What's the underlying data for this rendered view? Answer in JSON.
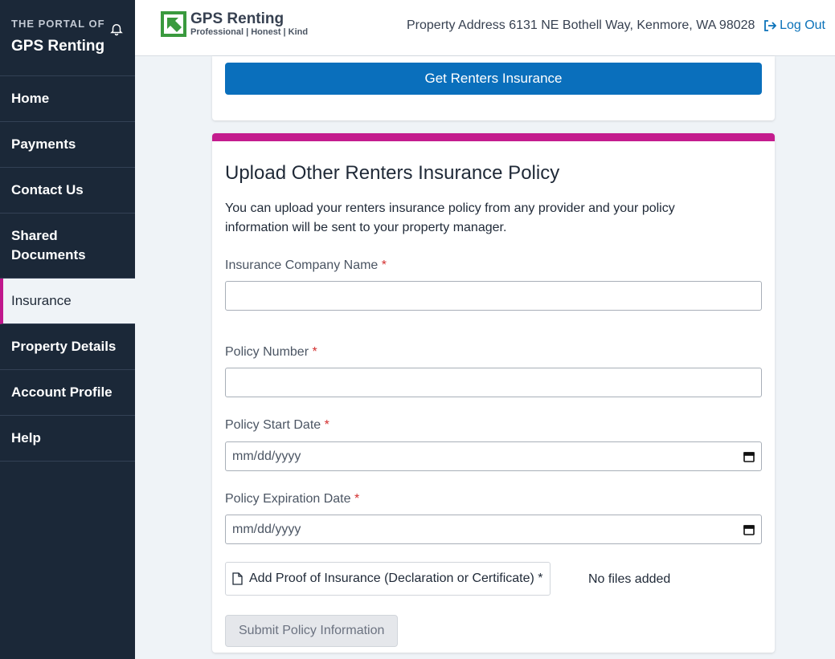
{
  "sidebar": {
    "portal_small": "THE PORTAL OF",
    "portal_name": "GPS Renting",
    "items": [
      {
        "label": "Home"
      },
      {
        "label": "Payments"
      },
      {
        "label": "Contact Us"
      },
      {
        "label": "Shared Documents"
      },
      {
        "label": "Insurance"
      },
      {
        "label": "Property Details"
      },
      {
        "label": "Account Profile"
      },
      {
        "label": "Help"
      }
    ],
    "active_item": "Insurance"
  },
  "header": {
    "logo_name": "GPS Renting",
    "logo_tagline": "Professional | Honest | Kind",
    "address_label": "Property Address",
    "address_value": "6131 NE Bothell Way, Kenmore, WA 98028",
    "logout_label": "Log Out"
  },
  "top_card": {
    "button_label": "Get Renters Insurance"
  },
  "upload_card": {
    "title": "Upload Other Renters Insurance Policy",
    "description": "You can upload your renters insurance policy from any provider and your policy information will be sent to your property manager.",
    "fields": {
      "company": {
        "label": "Insurance Company Name",
        "required_mark": "*",
        "value": ""
      },
      "policy_number": {
        "label": "Policy Number",
        "required_mark": "*",
        "value": ""
      },
      "start_date": {
        "label": "Policy Start Date",
        "required_mark": "*",
        "placeholder": "mm/dd/yyyy"
      },
      "expiration_date": {
        "label": "Policy Expiration Date",
        "required_mark": "*",
        "placeholder": "mm/dd/yyyy"
      }
    },
    "upload_label": "Add Proof of Insurance (Declaration or Certificate) *",
    "files_status": "No files added",
    "submit_label": "Submit Policy Information"
  },
  "colors": {
    "sidebar_bg": "#1b2838",
    "accent_magenta": "#c41c8e",
    "primary_blue": "#0a6fbc",
    "page_bg": "#eff3f7"
  },
  "icons": [
    "bell-icon",
    "logo-arrow-icon",
    "logout-icon",
    "calendar-icon",
    "file-icon"
  ]
}
